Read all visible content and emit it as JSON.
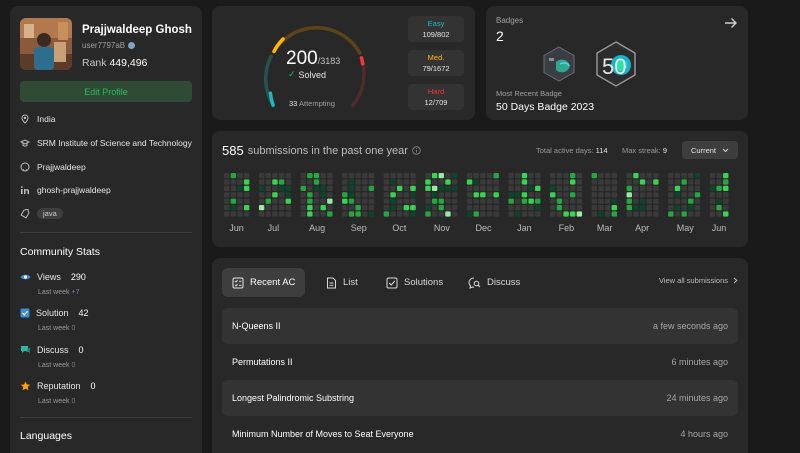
{
  "profile": {
    "name": "Prajjwaldeep Ghosh",
    "username": "user7797aB",
    "rank_label": "Rank",
    "rank_value": "449,496",
    "edit_label": "Edit Profile",
    "location": "India",
    "school": "SRM Institute of Science and Technology",
    "github": "Prajjwaldeep",
    "linkedin": "ghosh-prajjwaldeep",
    "skill_tag": "java"
  },
  "community": {
    "title": "Community Stats",
    "items": [
      {
        "label": "Views",
        "value": "290",
        "sub": "Last week",
        "delta": "+7"
      },
      {
        "label": "Solution",
        "value": "42",
        "sub": "Last week",
        "delta": "0"
      },
      {
        "label": "Discuss",
        "value": "0",
        "sub": "Last week",
        "delta": "0"
      },
      {
        "label": "Reputation",
        "value": "0",
        "sub": "Last week",
        "delta": "0"
      }
    ],
    "languages_title": "Languages"
  },
  "solved": {
    "count": "200",
    "total": "/3183",
    "label": "Solved",
    "attempting_count": "33",
    "attempting_label": "Attempting",
    "difficulty": [
      {
        "label": "Easy",
        "value": "109/802",
        "color": "#1cbaba"
      },
      {
        "label": "Med.",
        "value": "79/1672",
        "color": "#ffb700"
      },
      {
        "label": "Hard",
        "value": "12/709",
        "color": "#f63737"
      }
    ]
  },
  "badges": {
    "title": "Badges",
    "count": "2",
    "recent_label": "Most Recent Badge",
    "recent_value": "50 Days Badge 2023",
    "badge_number": "50"
  },
  "submissions": {
    "count": "585",
    "title": "submissions in the past one year",
    "active_label": "Total active days:",
    "active_value": "114",
    "streak_label": "Max streak:",
    "streak_value": "9",
    "selector": "Current",
    "months": [
      "Jun",
      "Jul",
      "Aug",
      "Sep",
      "Oct",
      "Nov",
      "Dec",
      "Jan",
      "Feb",
      "Mar",
      "Apr",
      "May",
      "Jun"
    ]
  },
  "recent": {
    "tabs": [
      "Recent AC",
      "List",
      "Solutions",
      "Discuss"
    ],
    "view_all": "View all submissions",
    "items": [
      {
        "title": "N-Queens II",
        "time": "a few seconds ago"
      },
      {
        "title": "Permutations II",
        "time": "6 minutes ago"
      },
      {
        "title": "Longest Palindromic Substring",
        "time": "24 minutes ago"
      },
      {
        "title": "Minimum Number of Moves to Seat Everyone",
        "time": "4 hours ago"
      }
    ]
  }
}
